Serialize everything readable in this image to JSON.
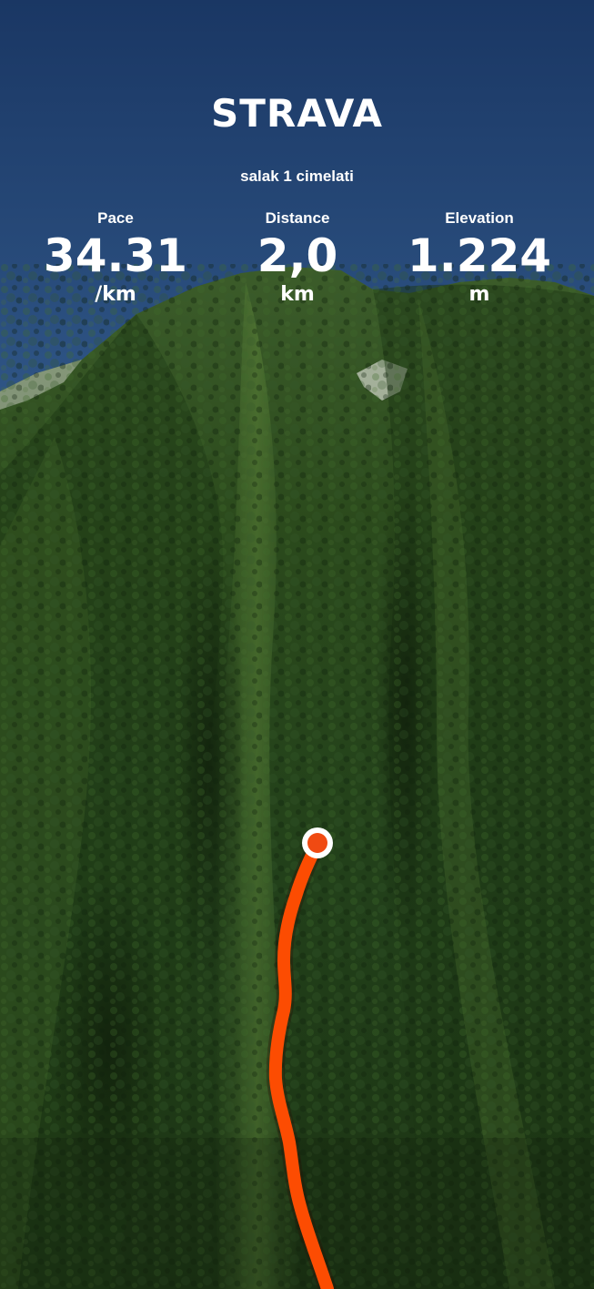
{
  "brand": {
    "logo_text": "STRAVA"
  },
  "activity": {
    "name": "salak 1 cimelati"
  },
  "stats": {
    "pace": {
      "label": "Pace",
      "value": "34.31",
      "unit": "/km"
    },
    "distance": {
      "label": "Distance",
      "value": "2,0",
      "unit": "km"
    },
    "elevation": {
      "label": "Elevation",
      "value": "1.224",
      "unit": "m"
    }
  },
  "colors": {
    "route": "#fc4c02",
    "sky_top": "#1c3b6b",
    "sky_bottom": "#6d9dcb",
    "forest_dark": "#14260f",
    "forest_mid": "#2e4f1f",
    "forest_light": "#4a6e2e",
    "text": "#ffffff"
  },
  "icons": {
    "route_end_marker": "end-marker-icon"
  }
}
